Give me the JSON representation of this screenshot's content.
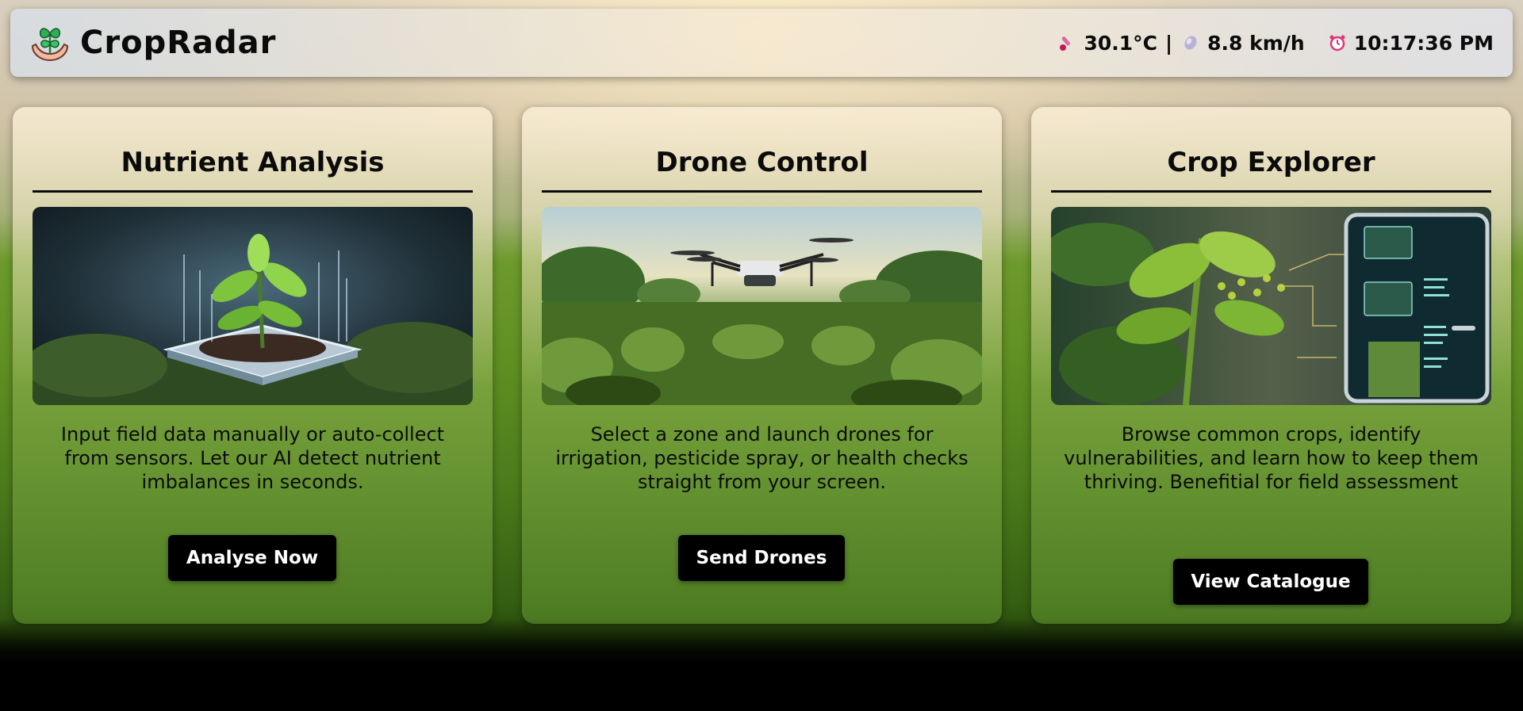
{
  "brand": {
    "name": "CropRadar",
    "logo_icon": "plant-hands-icon"
  },
  "status": {
    "temperature": "30.1°C",
    "separator": "|",
    "wind": "8.8 km/h",
    "time": "10:17:36 PM",
    "temperature_icon": "thermometer-icon",
    "wind_icon": "wind-icon",
    "clock_icon": "alarm-clock-icon"
  },
  "cards": [
    {
      "title": "Nutrient Analysis",
      "description": "Input field data manually or auto-collect from sensors. Let our AI detect nutrient imbalances in seconds.",
      "button": "Analyse Now"
    },
    {
      "title": "Drone Control",
      "description": "Select a zone and launch drones for irrigation, pesticide spray, or health checks straight from your screen.",
      "button": "Send Drones"
    },
    {
      "title": "Crop Explorer",
      "description": "Browse common crops, identify vulnerabilities, and learn how to keep them thriving. Benefitial for field assessment",
      "button": "View Catalogue"
    }
  ]
}
